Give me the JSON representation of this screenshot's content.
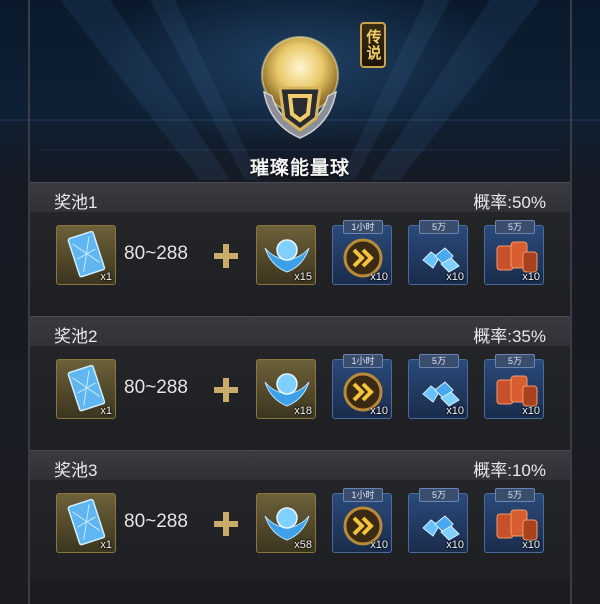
{
  "header": {
    "item_name": "璀璨能量球",
    "rarity_tag": "传说"
  },
  "colors": {
    "accent_gold": "#c9a24a",
    "slot_blue": "#2a4a7a",
    "panel_dark": "#1e1f23"
  },
  "pools": [
    {
      "name": "奖池1",
      "rate": "概率:50%",
      "range": "80~288",
      "items": [
        {
          "icon": "blue-crystal-card-icon",
          "count": "x1",
          "tag": ""
        },
        {
          "icon": "blue-wings-emblem-icon",
          "count": "x15",
          "tag": ""
        },
        {
          "icon": "speedup-chevron-icon",
          "count": "x10",
          "tag": "1小时"
        },
        {
          "icon": "blue-crystals-icon",
          "count": "x10",
          "tag": "5万"
        },
        {
          "icon": "oil-barrels-icon",
          "count": "x10",
          "tag": "5万"
        }
      ]
    },
    {
      "name": "奖池2",
      "rate": "概率:35%",
      "range": "80~288",
      "items": [
        {
          "icon": "blue-crystal-card-icon",
          "count": "x1",
          "tag": ""
        },
        {
          "icon": "blue-wings-emblem-icon",
          "count": "x18",
          "tag": ""
        },
        {
          "icon": "speedup-chevron-icon",
          "count": "x10",
          "tag": "1小时"
        },
        {
          "icon": "blue-crystals-icon",
          "count": "x10",
          "tag": "5万"
        },
        {
          "icon": "oil-barrels-icon",
          "count": "x10",
          "tag": "5万"
        }
      ]
    },
    {
      "name": "奖池3",
      "rate": "概率:10%",
      "range": "80~288",
      "items": [
        {
          "icon": "blue-crystal-card-icon",
          "count": "x1",
          "tag": ""
        },
        {
          "icon": "blue-wings-emblem-icon",
          "count": "x58",
          "tag": ""
        },
        {
          "icon": "speedup-chevron-icon",
          "count": "x10",
          "tag": "1小时"
        },
        {
          "icon": "blue-crystals-icon",
          "count": "x10",
          "tag": "5万"
        },
        {
          "icon": "oil-barrels-icon",
          "count": "x10",
          "tag": "5万"
        }
      ]
    }
  ]
}
